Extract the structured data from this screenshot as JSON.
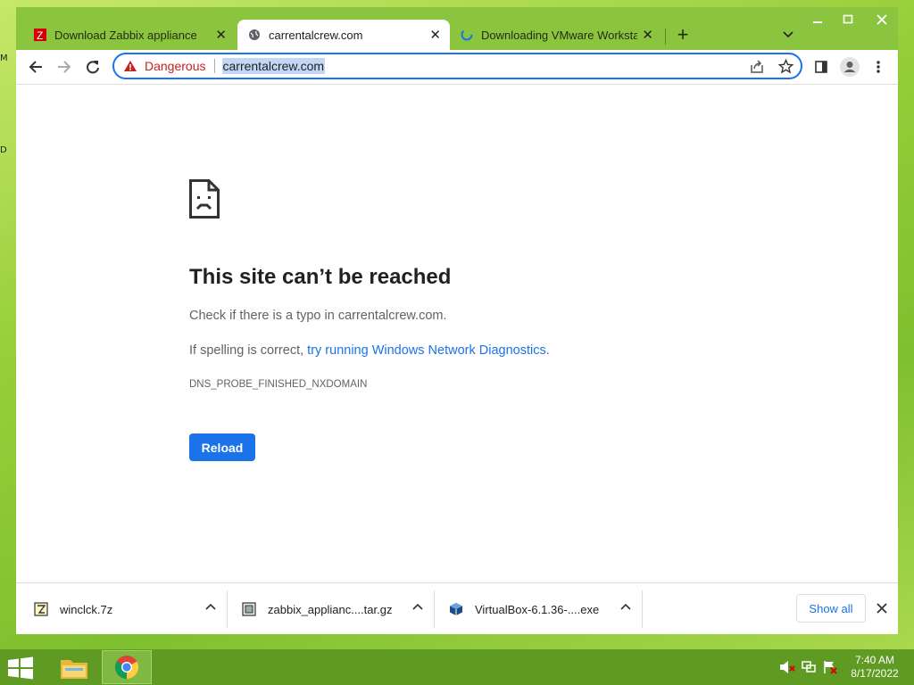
{
  "window": {
    "tabs": [
      {
        "title": "Download Zabbix appliance",
        "favicon": "zabbix-icon"
      },
      {
        "title": "carrentalcrew.com",
        "favicon": "globe-icon"
      },
      {
        "title": "Downloading VMware Workstati",
        "favicon": "loading-spinner-icon"
      }
    ],
    "new_tab_glyph": "+"
  },
  "toolbar": {
    "security_label": "Dangerous",
    "url": "carrentalcrew.com"
  },
  "error_page": {
    "title": "This site can’t be reached",
    "check_text": "Check if there is a typo in carrentalcrew.com.",
    "spelling_prefix": "If spelling is correct, ",
    "diagnostics_link": "try running Windows Network Diagnostics",
    "spelling_suffix": ".",
    "error_code": "DNS_PROBE_FINISHED_NXDOMAIN",
    "reload_label": "Reload"
  },
  "downloads": {
    "items": [
      {
        "name": "winclck.7z",
        "icon": "archive-icon"
      },
      {
        "name": "zabbix_applianc....tar.gz",
        "icon": "archive-icon"
      },
      {
        "name": "VirtualBox-6.1.36-....exe",
        "icon": "virtualbox-icon"
      }
    ],
    "show_all_label": "Show all"
  },
  "desktop": {
    "edge_letters": [
      "M",
      "D"
    ]
  },
  "taskbar": {
    "time": "7:40 AM",
    "date": "8/17/2022"
  },
  "colors": {
    "accent": "#1a73e8",
    "danger": "#c5221f",
    "titlebar": "#8bc53f"
  }
}
